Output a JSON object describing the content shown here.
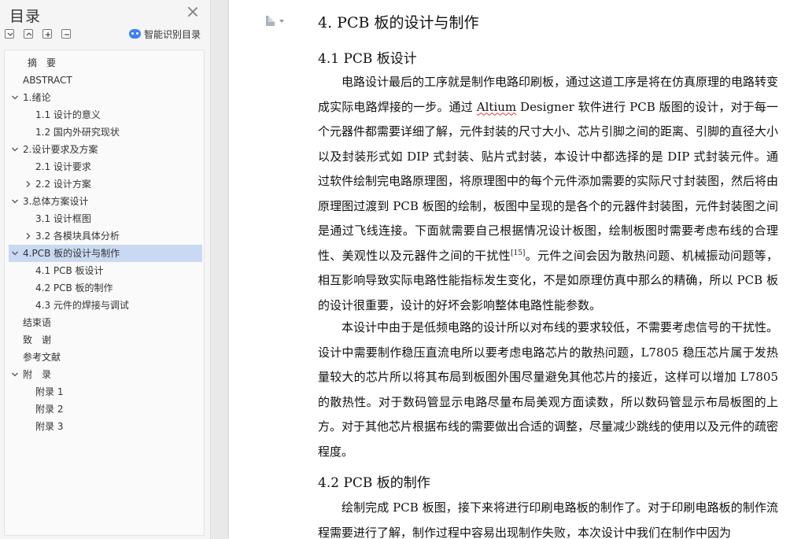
{
  "toc": {
    "title": "目录",
    "smart_label": "智能识别目录",
    "items": [
      {
        "label": "摘　要"
      },
      {
        "label": "ABSTRACT"
      },
      {
        "label": "1.绪论"
      },
      {
        "label": "1.1 设计的意义"
      },
      {
        "label": "1.2 国内外研究现状"
      },
      {
        "label": "2.设计要求及方案"
      },
      {
        "label": "2.1 设计要求"
      },
      {
        "label": "2.2 设计方案"
      },
      {
        "label": "3.总体方案设计"
      },
      {
        "label": "3.1 设计框图"
      },
      {
        "label": "3.2 各模块具体分析"
      },
      {
        "label": "4.PCB 板的设计与制作"
      },
      {
        "label": "4.1 PCB 板设计"
      },
      {
        "label": "4.2 PCB 板的制作"
      },
      {
        "label": "4.3 元件的焊接与调试"
      },
      {
        "label": "结束语"
      },
      {
        "label": "致　谢"
      },
      {
        "label": "参考文献"
      },
      {
        "label": "附　录"
      },
      {
        "label": "附录 1"
      },
      {
        "label": "附录 2"
      },
      {
        "label": "附录 3"
      }
    ]
  },
  "document": {
    "heading1": "4.  PCB 板的设计与制作",
    "heading2a": "4.1 PCB 板设计",
    "p1a": "电路设计最后的工序就是制作电路印刷板，通过这道工序是将在仿真原理的电路转变成实际电路焊接的一步。通过 ",
    "p1_altium": "Altium",
    "p1b": " Designer 软件进行 PCB 版图的设计，对于每一个元器件都需要详细了解，元件封装的尺寸大小、芯片引脚之间的距离、引脚的直径大小以及封装形式如 DIP 式封装、贴片式封装，本设计中都选择的是 DIP 式封装元件。通过软件绘制完电路原理图，将原理图中的每个元件添加需要的实际尺寸封装图，然后将由原理图过渡到 PCB 板图的绘制，板图中呈现的是各个的元器件封装图，元件封装图之间是通过飞线连接。下面就需要自己根据情况设计板图，绘制板图时需要考虑布线的合理性、美观性以及元器件之间的干扰性",
    "p1_ref": "[15]",
    "p1c": "。元件之间会因为散热问题、机械振动问题等，相互影响导致实际电路性能指标发生变化，不是如原理仿真中那么的精确，所以 PCB 板的设计很重要，设计的好坏会影响整体电路性能参数。",
    "p2": "本设计中由于是低频电路的设计所以对布线的要求较低，不需要考虑信号的干扰性。设计中需要制作稳压直流电所以要考虑电路芯片的散热问题，L7805 稳压芯片属于发热量较大的芯片所以将其布局到板图外围尽量避免其他芯片的接近，这样可以增加 L7805 的散热性。对于数码管显示电路尽量布局美观方面读数，所以数码管显示布局板图的上方。对于其他芯片根据布线的需要做出合适的调整，尽量减少跳线的使用以及元件的疏密程度。",
    "heading2b": "4.2 PCB 板的制作",
    "p3": "绘制完成 PCB 板图，接下来将进行印刷电路板的制作了。对于印刷电路板的制作流程需要进行了解，制作过程中容易出现制作失败，本次设计中我们在制作中因为"
  }
}
